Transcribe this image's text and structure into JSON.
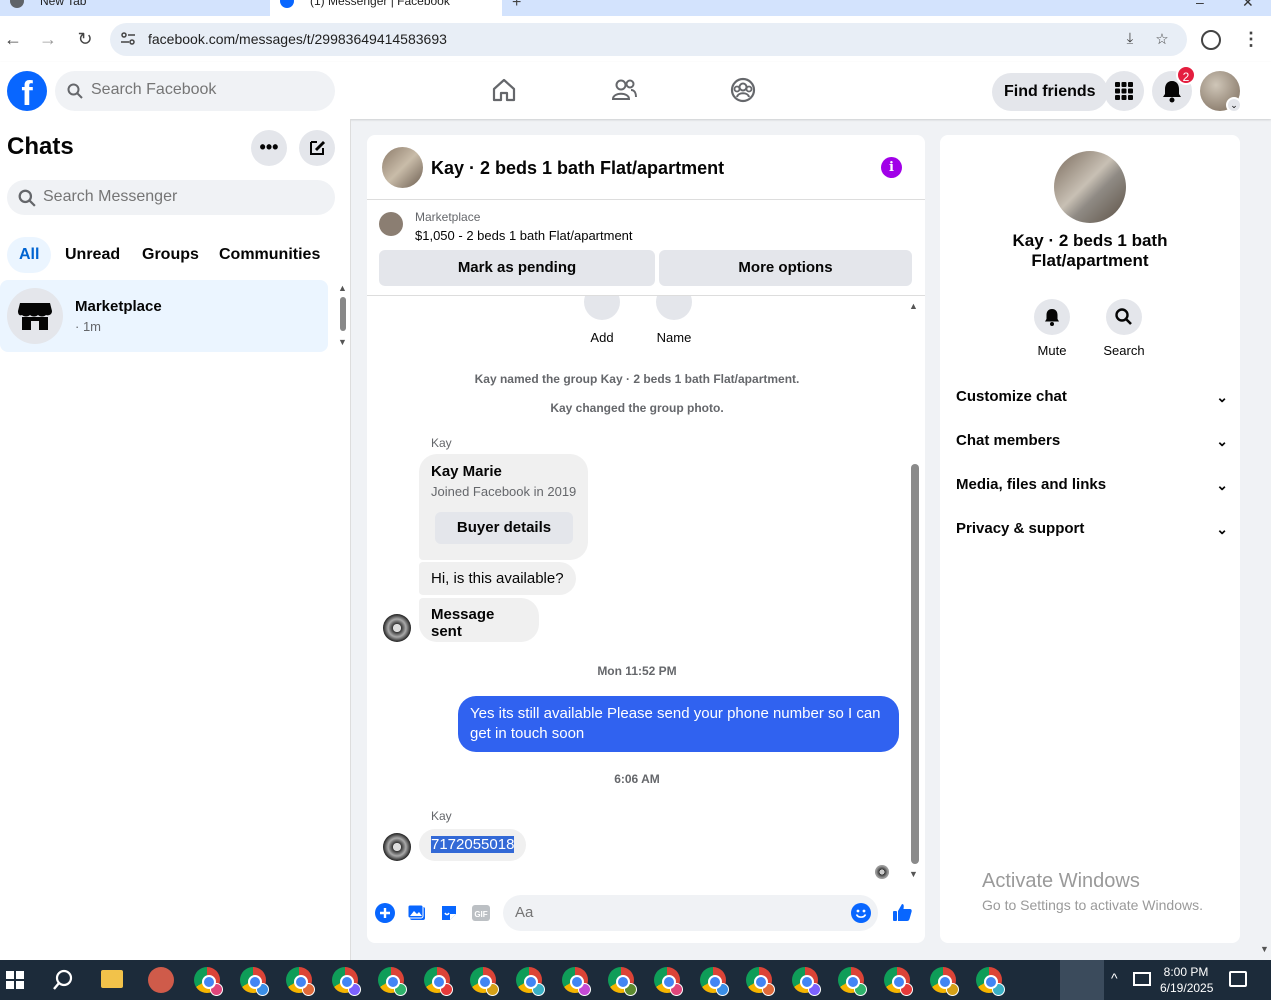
{
  "browser": {
    "tabs": [
      {
        "label": "New Tab",
        "active": false
      },
      {
        "label": "(1) Messenger | Facebook",
        "active": true
      }
    ],
    "url": "facebook.com/messages/t/29983649414583693"
  },
  "fb": {
    "search_placeholder": "Search Facebook",
    "find_friends": "Find friends",
    "notification_count": "2",
    "brand_color": "#0866ff"
  },
  "chats": {
    "title": "Chats",
    "search_placeholder": "Search Messenger",
    "filters": [
      "All",
      "Unread",
      "Groups",
      "Communities"
    ],
    "active_filter": "All",
    "items": [
      {
        "name": "Marketplace",
        "time": "· 1m"
      }
    ]
  },
  "conversation": {
    "title": "Kay · 2 beds 1 bath Flat/apartment",
    "marketplace": {
      "label": "Marketplace",
      "listing": "$1,050 - 2 beds 1 bath Flat/apartment",
      "pending_btn": "Mark as pending",
      "options_btn": "More options"
    },
    "quick_actions": [
      "Add",
      "Name"
    ],
    "system_messages": [
      "Kay named the group Kay · 2 beds 1 bath Flat/apartment.",
      "Kay changed the group photo."
    ],
    "sender_name": "Kay",
    "buyer_card": {
      "name": "Kay Marie",
      "joined": "Joined Facebook in 2019",
      "button": "Buyer details"
    },
    "messages": [
      {
        "from": "Kay",
        "text": "Hi, is this available?"
      },
      {
        "from": "Kay",
        "text": "Message sent"
      },
      {
        "timestamp": "Mon 11:52 PM"
      },
      {
        "from": "me",
        "text": "Yes its still available Please send your phone number so I can get in touch soon"
      },
      {
        "timestamp": "6:06 AM"
      },
      {
        "from": "Kay",
        "text": "7172055018"
      }
    ],
    "composer_placeholder": "Aa",
    "outgoing_color": "#3062f0"
  },
  "info_panel": {
    "name": "Kay · 2 beds 1 bath Flat/apartment",
    "actions": [
      "Mute",
      "Search"
    ],
    "sections": [
      "Customize chat",
      "Chat members",
      "Media, files and links",
      "Privacy & support"
    ]
  },
  "watermark": {
    "line1": "Activate Windows",
    "line2": "Go to Settings to activate Windows."
  },
  "taskbar": {
    "time": "8:00 PM",
    "date": "6/19/2025"
  }
}
